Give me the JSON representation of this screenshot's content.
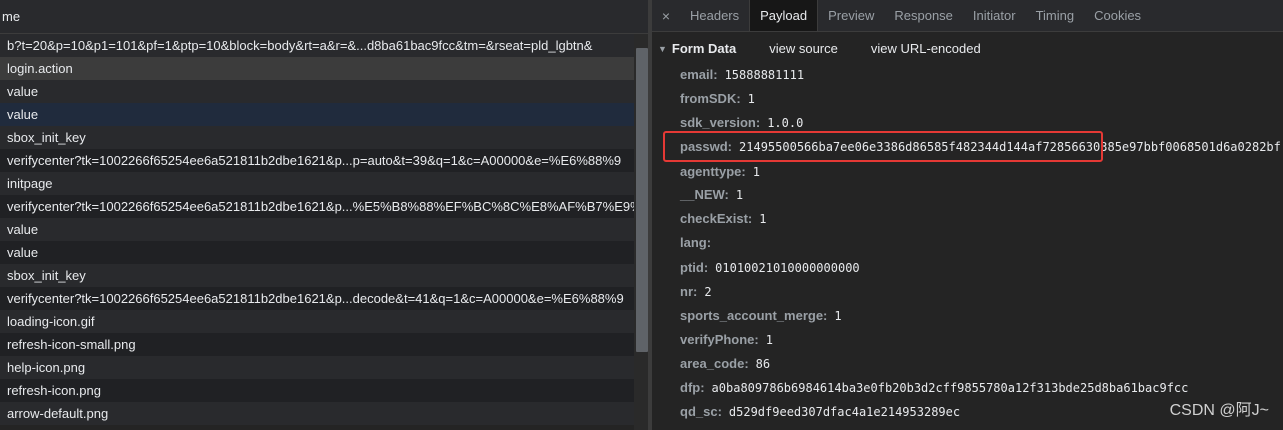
{
  "left_panel": {
    "header": "me",
    "rows": [
      "b?t=20&p=10&p1=101&pf=1&ptp=10&block=body&rt=a&r=&...d8ba61bac9fcc&tm=&rseat=pld_lgbtn&",
      "login.action",
      "value",
      "value",
      "sbox_init_key",
      "verifycenter?tk=1002266f65254ee6a521811b2dbe1621&p...p=auto&t=39&q=1&c=A00000&e=%E6%88%9",
      "initpage",
      "verifycenter?tk=1002266f65254ee6a521811b2dbe1621&p...%E5%B8%88%EF%BC%8C%E8%AF%B7%E9%87",
      "value",
      "value",
      "sbox_init_key",
      "verifycenter?tk=1002266f65254ee6a521811b2dbe1621&p...decode&t=41&q=1&c=A00000&e=%E6%88%9",
      "loading-icon.gif",
      "refresh-icon-small.png",
      "help-icon.png",
      "refresh-icon.png",
      "arrow-default.png"
    ]
  },
  "right_panel": {
    "close_glyph": "×",
    "tabs": [
      "Headers",
      "Payload",
      "Preview",
      "Response",
      "Initiator",
      "Timing",
      "Cookies"
    ],
    "active_tab": "Payload",
    "form_data": {
      "title": "Form Data",
      "view_source": "view source",
      "view_url_encoded": "view URL-encoded",
      "fields": [
        {
          "key": "email:",
          "value": "15888881111"
        },
        {
          "key": "fromSDK:",
          "value": "1"
        },
        {
          "key": "sdk_version:",
          "value": "1.0.0"
        },
        {
          "key": "passwd:",
          "value": "21495500566ba7ee06e3386d86585f482344d144af72856630385e97bbf0068501d6a0282bf"
        },
        {
          "key": "agenttype:",
          "value": "1"
        },
        {
          "key": "__NEW:",
          "value": "1"
        },
        {
          "key": "checkExist:",
          "value": "1"
        },
        {
          "key": "lang:",
          "value": ""
        },
        {
          "key": "ptid:",
          "value": "01010021010000000000"
        },
        {
          "key": "nr:",
          "value": "2"
        },
        {
          "key": "sports_account_merge:",
          "value": "1"
        },
        {
          "key": "verifyPhone:",
          "value": "1"
        },
        {
          "key": "area_code:",
          "value": "86"
        },
        {
          "key": "dfp:",
          "value": "a0ba809786b6984614ba3e0fb20b3d2cff9855780a12f313bde25d8ba61bac9fcc"
        },
        {
          "key": "qd_sc:",
          "value": "d529df9eed307dfac4a1e214953289ec"
        }
      ]
    }
  },
  "watermark": "CSDN @阿J~",
  "colors": {
    "background": "#202124",
    "highlight_box": "#e53935",
    "selected_row": "#202b3d"
  }
}
